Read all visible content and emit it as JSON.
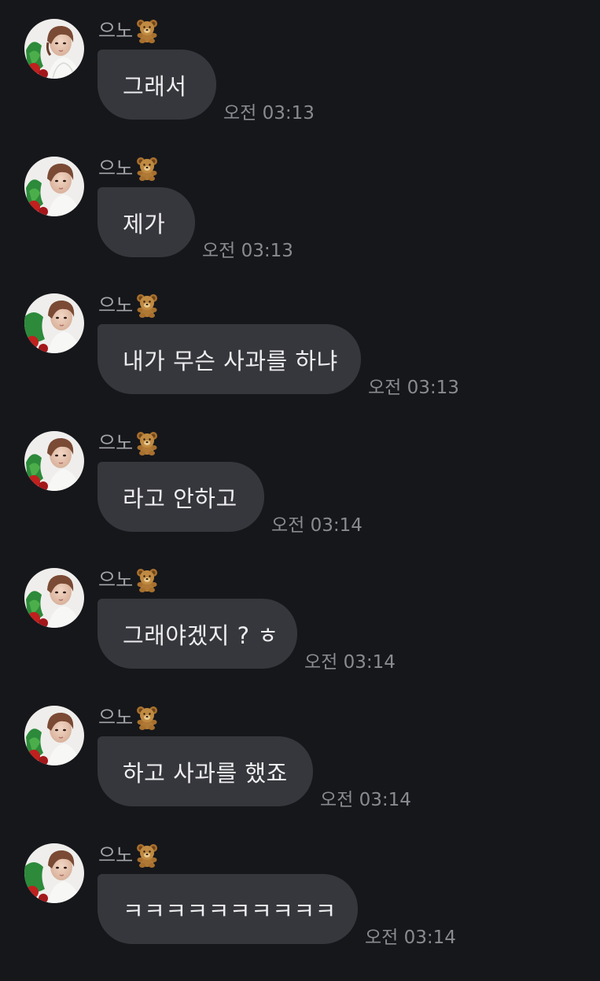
{
  "sender_name": "으노",
  "sender_emoji_icon": "teddy-bear-icon",
  "avatar_icon": "profile-photo-avatar",
  "messages": [
    {
      "text": "그래서",
      "time": "오전 03:13"
    },
    {
      "text": "제가",
      "time": "오전 03:13"
    },
    {
      "text": "내가 무슨 사과를 하냐",
      "time": "오전 03:13"
    },
    {
      "text": "라고 안하고",
      "time": "오전 03:14"
    },
    {
      "text": "그래야겠지 ? ㅎ",
      "time": "오전 03:14"
    },
    {
      "text": "하고 사과를 했죠",
      "time": "오전 03:14"
    },
    {
      "text": "ㅋㅋㅋㅋㅋㅋㅋㅋㅋㅋ",
      "time": "오전 03:14"
    }
  ]
}
